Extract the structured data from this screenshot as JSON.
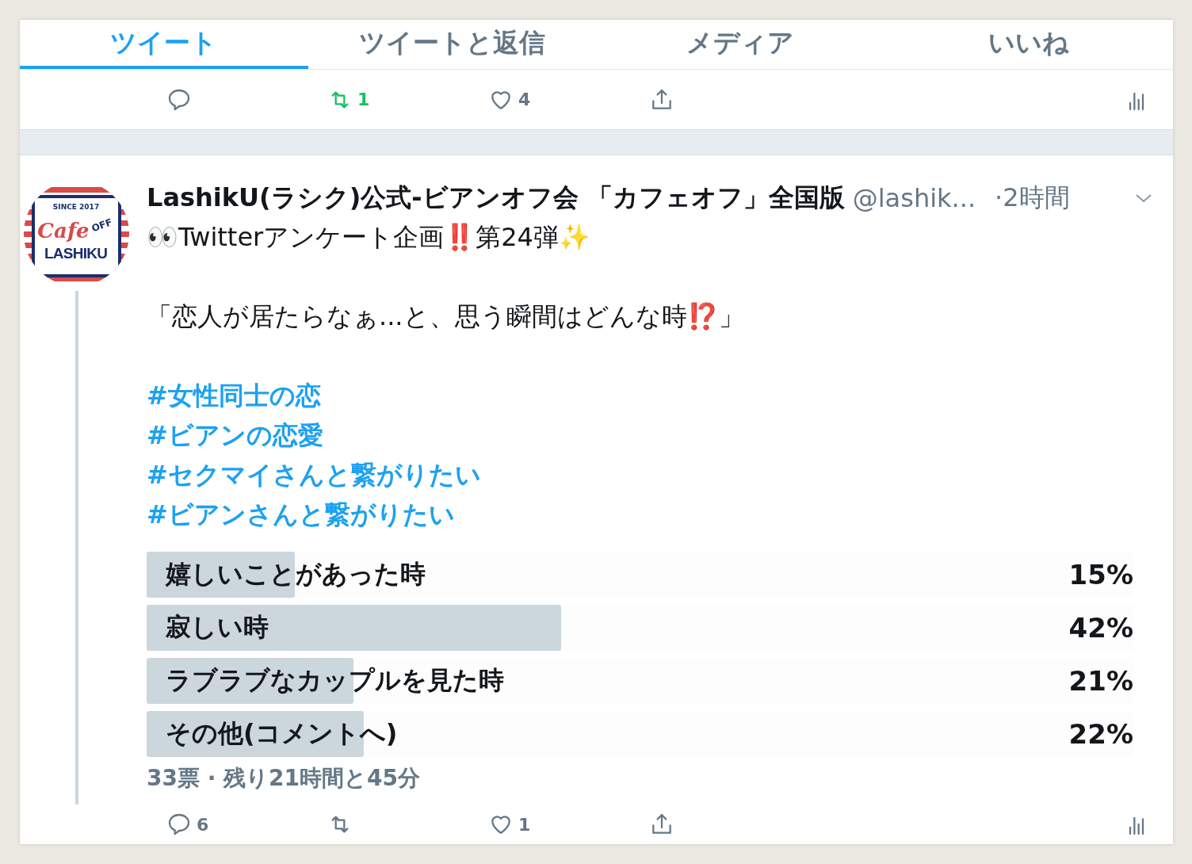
{
  "tabs": [
    {
      "label": "ツイート",
      "selected": true
    },
    {
      "label": "ツイートと返信",
      "selected": false
    },
    {
      "label": "メディア",
      "selected": false
    },
    {
      "label": "いいね",
      "selected": false
    }
  ],
  "top_actions": [
    {
      "kind": "reply",
      "active": false
    },
    {
      "kind": "retweet",
      "count": "1",
      "active": true
    },
    {
      "kind": "like",
      "count": "4",
      "active": false
    },
    {
      "kind": "share",
      "active": false
    },
    {
      "kind": "analytics",
      "active": false
    }
  ],
  "tweet": {
    "avatar": {
      "since": "SINCE 2017",
      "script": "Cafe",
      "badge": "OFF",
      "name": "LASHIKU"
    },
    "author_name": "LashikU(ラシク)公式-ビアンオフ会 「カフェオフ」全国版",
    "handle": "@lashik...",
    "time": "·2時間",
    "body": [
      "👀Twitterアンケート企画‼️第24弾✨",
      "「恋人が居たらなぁ...と、思う瞬間はどんな時⁉️」"
    ],
    "hashtags": [
      "#女性同士の恋",
      "#ビアンの恋愛",
      "#セクマイさんと繋がりたい",
      "#ビアンさんと繋がりたい"
    ],
    "poll": [
      {
        "label": "嬉しいことがあった時",
        "percent": "15%",
        "level": 0.15
      },
      {
        "label": "寂しい時",
        "percent": "42%",
        "level": 0.42
      },
      {
        "label": "ラブラブなカップルを見た時",
        "percent": "21%",
        "level": 0.21
      },
      {
        "label": "その他(コメントへ)",
        "percent": "22%",
        "level": 0.22
      }
    ],
    "poll_summary": "33票 · 残り21時間と45分",
    "actions": [
      {
        "kind": "reply",
        "count": "6",
        "active": false
      },
      {
        "kind": "retweet",
        "active": false
      },
      {
        "kind": "like",
        "count": "1",
        "active": false
      },
      {
        "kind": "share",
        "active": false
      },
      {
        "kind": "analytics",
        "active": false
      }
    ]
  }
}
